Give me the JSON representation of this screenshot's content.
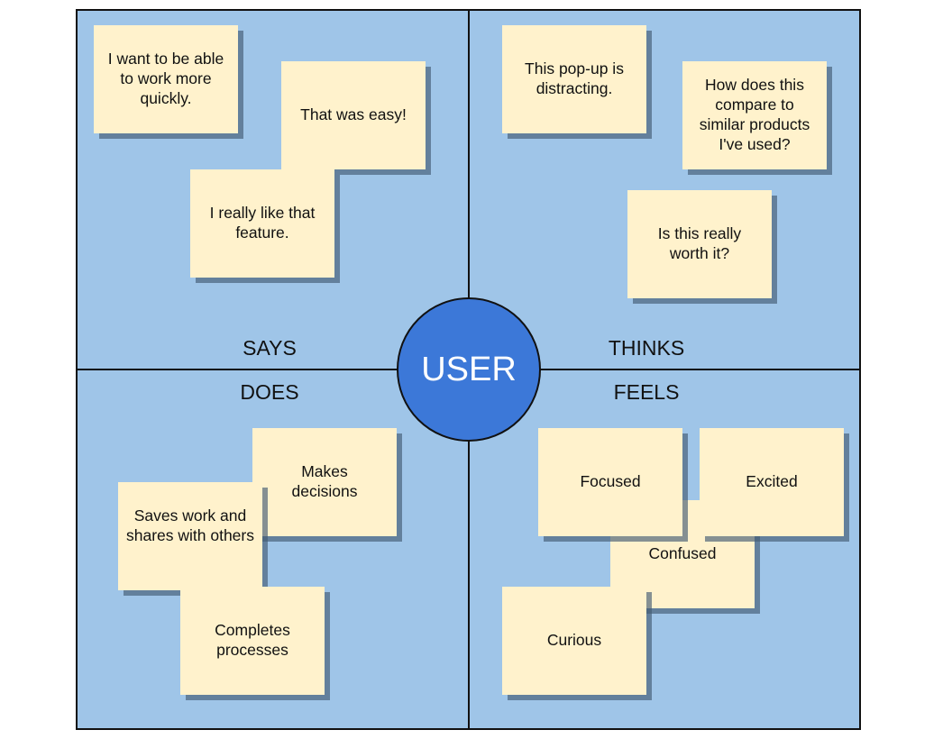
{
  "center": {
    "label": "USER",
    "color": "#3c78d8"
  },
  "colors": {
    "board": "#9fc5e8",
    "note": "#fff2cc"
  },
  "quadrants": {
    "says": {
      "label": "SAYS",
      "notes": [
        "I want to be able to work more quickly.",
        "That was easy!",
        "I really like that feature."
      ]
    },
    "thinks": {
      "label": "THINKS",
      "notes": [
        "This pop-up is distracting.",
        "How does this compare to similar products I've used?",
        "Is this really worth it?"
      ]
    },
    "does": {
      "label": "DOES",
      "notes": [
        "Makes decisions",
        "Saves work and shares with others",
        "Completes processes"
      ]
    },
    "feels": {
      "label": "FEELS",
      "notes": [
        "Confused",
        "Focused",
        "Excited",
        "Curious"
      ]
    }
  }
}
